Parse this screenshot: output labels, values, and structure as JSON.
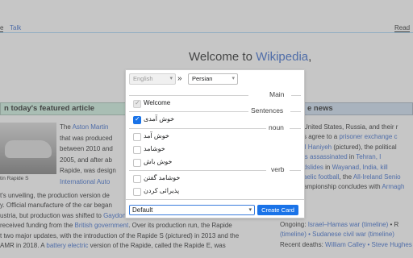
{
  "page": {
    "tab_main": "Talk",
    "tab_main0": "e",
    "tab_read": "Read",
    "welcome_prefix": "Welcome to ",
    "welcome_link": "Wikipedia",
    "welcome_suffix": ",",
    "featured_heading": "n today's featured article",
    "news_heading": "e news",
    "car_caption": "tin Rapide S",
    "left_lines": [
      [
        "The ",
        "Aston Martin",
        ""
      ],
      [
        "that was produced",
        "",
        ""
      ],
      [
        "between 2010 and",
        "",
        ""
      ],
      [
        "2005, and after ab",
        "",
        ""
      ],
      [
        "Rapide, was design",
        "",
        ""
      ],
      [
        "International Auto",
        "",
        ""
      ],
      [
        "t's unveiling, the production version de",
        "",
        ""
      ],
      [
        "y. Official manufacture of the car began",
        "",
        ""
      ],
      [
        "ustria, but production was shifted to ",
        "Gaydon, Warwickshire",
        ", in 2012 after Aston"
      ],
      [
        "received funding from the ",
        "British government",
        ". Over its production run, the Rapide"
      ],
      [
        "t two major updates, with the introduction of the Rapide S (pictured) in 2013 and the",
        "",
        ""
      ],
      [
        "AMR in 2018. A ",
        "battery electric",
        " version of the Rapide, called the Rapide E, was"
      ]
    ],
    "right_lines": [
      [
        "United States, Russia, and their r",
        "",
        ""
      ],
      [
        "s agree to a ",
        "prisoner exchange c",
        ""
      ],
      [
        "il Haniyeh",
        " (pictured), the political",
        ""
      ],
      [
        "is assassinated",
        " in ",
        "Tehran, I"
      ],
      [
        "dslides",
        " in ",
        "Wayanad, India, kill"
      ],
      [
        "aelic football",
        ", the ",
        "All-Ireland Senio"
      ],
      [
        "ampionship concludes with ",
        "Armagh",
        ""
      ],
      [
        "Ongoing: ",
        "Israel–Hamas war (timeline)",
        " • R"
      ],
      [
        "(timeline) • Sudanese civil war (timeline)",
        "",
        ""
      ],
      [
        "Recent deaths: ",
        "William Calley • Steve Hughes",
        ""
      ]
    ]
  },
  "popup": {
    "source_lang": "English",
    "target_lang": "Persian",
    "swap_icon": "»",
    "sections": {
      "main": "Main",
      "sentences": "Sentences",
      "noun": "noun",
      "verb": "verb"
    },
    "items": {
      "welcome": "Welcome",
      "sentence_1": "خوش آمدی",
      "noun_1": "خوش آمد",
      "noun_2": "خوشامد",
      "noun_3": "خوش باش",
      "verb_1": "خوشامد گفتن",
      "verb_2": "پذیرائی کردن"
    },
    "deck": "Default",
    "create_button": "Create Card"
  },
  "colors": {
    "accent": "#1a73e8",
    "link": "#3366cc"
  }
}
